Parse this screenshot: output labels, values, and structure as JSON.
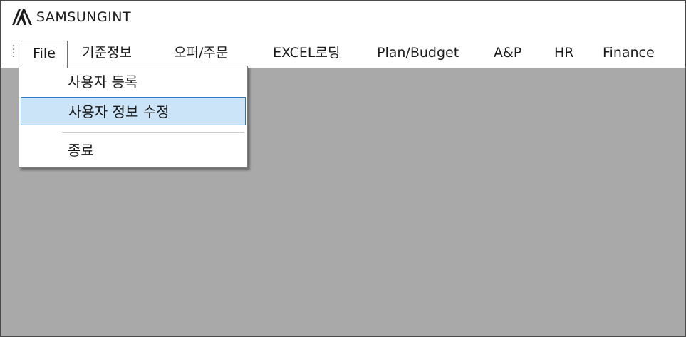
{
  "app": {
    "title": "SAMSUNGINT"
  },
  "menubar": {
    "items": [
      {
        "label": "File",
        "active": true
      },
      {
        "label": "기준정보"
      },
      {
        "label": "오퍼/주문"
      },
      {
        "label": "EXCEL로딩"
      },
      {
        "label": "Plan/Budget"
      },
      {
        "label": "A&P"
      },
      {
        "label": "HR"
      },
      {
        "label": "Finance"
      }
    ]
  },
  "file_menu": {
    "items": [
      {
        "label": "사용자 등록"
      },
      {
        "label": "사용자 정보 수정",
        "highlighted": true
      },
      {
        "label": "종료"
      }
    ]
  },
  "colors": {
    "workspace": "#a9a9a9",
    "highlight_fill": "#cce4f7",
    "highlight_border": "#2a78c8"
  },
  "icons": {
    "logo": "samsung-logo-icon",
    "grip": "menu-grip-icon"
  }
}
